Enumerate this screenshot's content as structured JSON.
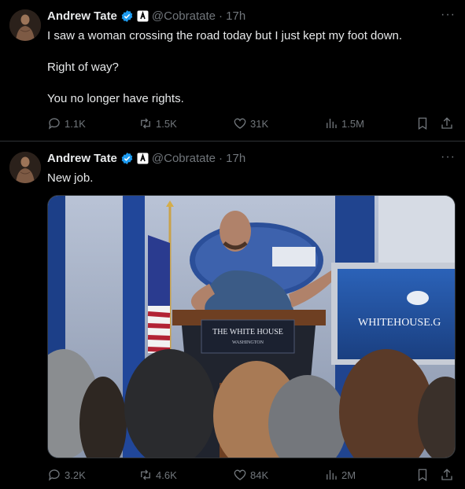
{
  "tweets": [
    {
      "author": {
        "name": "Andrew Tate",
        "handle": "@Cobratate",
        "time": "· 17h"
      },
      "lines": [
        "I saw a woman crossing the road today but I just kept my foot down.",
        "Right of way?",
        "You no longer have rights."
      ],
      "stats": {
        "replies": "1.1K",
        "reposts": "1.5K",
        "likes": "31K",
        "views": "1.5M"
      }
    },
    {
      "author": {
        "name": "Andrew Tate",
        "handle": "@Cobratate",
        "time": "· 17h"
      },
      "lines": [
        "New job."
      ],
      "media": {
        "podium_sign_line1": "THE WHITE HOUSE",
        "podium_sign_line2": "WASHINGTON",
        "screen_text": "WHITEHOUSE.G"
      },
      "stats": {
        "replies": "3.2K",
        "reposts": "4.6K",
        "likes": "84K",
        "views": "2M"
      }
    }
  ],
  "colors": {
    "background": "#000000",
    "text": "#e7e9ea",
    "muted": "#71767b",
    "verified": "#1d9bf0"
  },
  "icons": [
    "reply-icon",
    "repost-icon",
    "like-icon",
    "views-icon",
    "bookmark-icon",
    "share-icon",
    "verified-icon",
    "more-icon"
  ]
}
